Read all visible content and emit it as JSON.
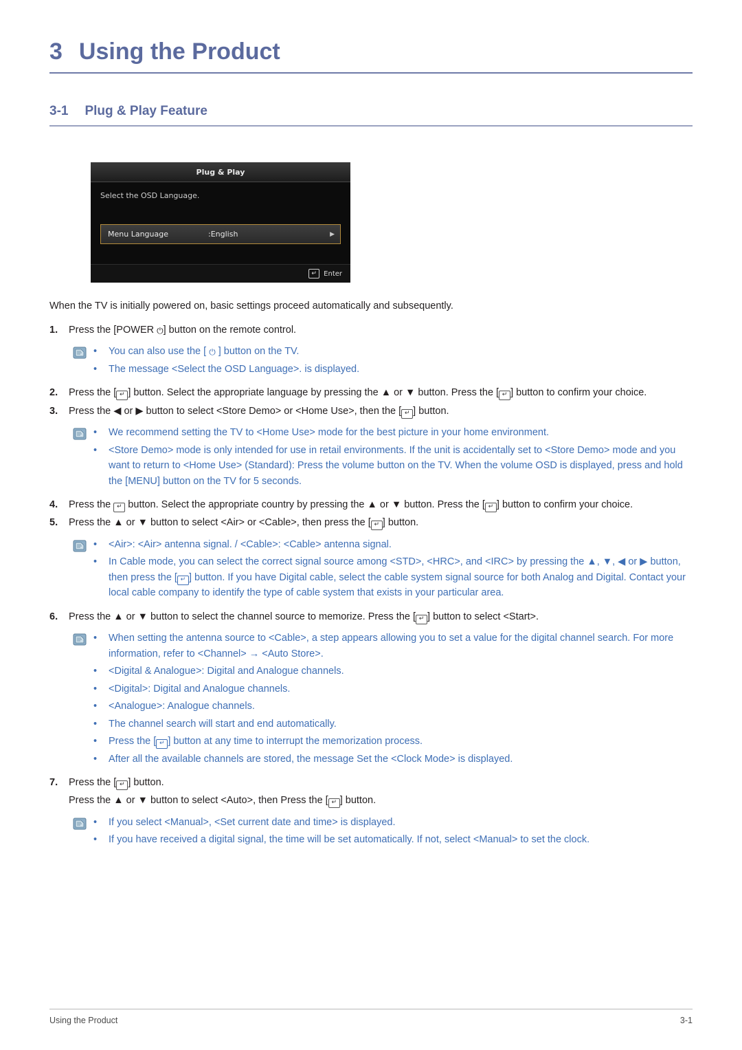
{
  "chapter": {
    "number": "3",
    "title": "Using the Product"
  },
  "section": {
    "number": "3-1",
    "title": "Plug & Play Feature"
  },
  "osd": {
    "title": "Plug & Play",
    "subtitle": "Select the OSD Language.",
    "row_label": "Menu Language",
    "row_value": ":English",
    "row_arrow": "▶",
    "footer_label": "Enter",
    "footer_key": "↵"
  },
  "intro": "When the TV is initially powered on, basic settings proceed automatically and subsequently.",
  "steps": [
    {
      "num": "1.",
      "parts": [
        {
          "t": "text",
          "v": "Press the [POWER "
        },
        {
          "t": "power",
          "v": "⏻"
        },
        {
          "t": "text",
          "v": "] button on the remote control."
        }
      ]
    },
    {
      "num": "2.",
      "parts": [
        {
          "t": "text",
          "v": "Press the ["
        },
        {
          "t": "key",
          "v": "↵"
        },
        {
          "t": "text",
          "v": "] button. Select the appropriate language by pressing the ▲ or ▼ button. Press the ["
        },
        {
          "t": "key",
          "v": "↵"
        },
        {
          "t": "text",
          "v": "] button to confirm your choice."
        }
      ]
    },
    {
      "num": "3.",
      "parts": [
        {
          "t": "text",
          "v": "Press the ◀ or ▶ button to select <Store Demo> or <Home Use>, then the ["
        },
        {
          "t": "key",
          "v": "↵"
        },
        {
          "t": "text",
          "v": "] button."
        }
      ]
    },
    {
      "num": "4.",
      "parts": [
        {
          "t": "text",
          "v": "Press the "
        },
        {
          "t": "key",
          "v": "↵"
        },
        {
          "t": "text",
          "v": " button. Select the appropriate country by pressing the ▲ or ▼ button. Press the ["
        },
        {
          "t": "key",
          "v": "↵"
        },
        {
          "t": "text",
          "v": "] button to confirm your choice."
        }
      ]
    },
    {
      "num": "5.",
      "parts": [
        {
          "t": "text",
          "v": "Press the ▲ or ▼ button to select <Air> or <Cable>, then press the ["
        },
        {
          "t": "key",
          "v": "↵"
        },
        {
          "t": "text",
          "v": "] button."
        }
      ]
    },
    {
      "num": "6.",
      "parts": [
        {
          "t": "text",
          "v": "Press the ▲ or ▼ button to select the channel source to memorize. Press the ["
        },
        {
          "t": "key",
          "v": "↵"
        },
        {
          "t": "text",
          "v": "] button to select <Start>."
        }
      ]
    },
    {
      "num": "7.",
      "parts": [
        {
          "t": "text",
          "v": "Press the ["
        },
        {
          "t": "key",
          "v": "↵"
        },
        {
          "t": "text",
          "v": "] button."
        }
      ]
    }
  ],
  "step7_extra": {
    "parts": [
      {
        "t": "text",
        "v": "Press the ▲ or ▼ button to select <Auto>, then Press the ["
      },
      {
        "t": "key",
        "v": "↵"
      },
      {
        "t": "text",
        "v": "] button."
      }
    ]
  },
  "notes": {
    "after_step1": [
      {
        "parts": [
          {
            "t": "text",
            "v": "You can also use the [ "
          },
          {
            "t": "power",
            "v": "⏻"
          },
          {
            "t": "text",
            "v": " ] button on the TV."
          }
        ]
      },
      {
        "parts": [
          {
            "t": "text",
            "v": "The message <Select the OSD Language>. is displayed."
          }
        ]
      }
    ],
    "after_step3": [
      {
        "parts": [
          {
            "t": "text",
            "v": "We recommend setting the TV to <Home Use> mode for the best picture in your home environment."
          }
        ]
      },
      {
        "parts": [
          {
            "t": "text",
            "v": "<Store Demo> mode is only intended for use in retail environments. If the unit is accidentally set to <Store Demo> mode and you want to return to <Home Use> (Standard): Press the volume button on the TV. When the volume OSD is displayed, press and hold the [MENU] button on the TV for 5 seconds."
          }
        ]
      }
    ],
    "after_step5": [
      {
        "parts": [
          {
            "t": "text",
            "v": "<Air>: <Air> antenna signal. / <Cable>: <Cable> antenna signal."
          }
        ]
      },
      {
        "parts": [
          {
            "t": "text",
            "v": "In Cable mode, you can select the correct signal source among <STD>, <HRC>, and <IRC> by pressing the ▲, ▼, ◀ or ▶ button, then press the ["
          },
          {
            "t": "key",
            "v": "↵"
          },
          {
            "t": "text",
            "v": "] button. If you have Digital cable, select the cable system signal source for both Analog and Digital. Contact your local cable company to identify the type of cable system that exists in your particular area."
          }
        ]
      }
    ],
    "after_step6": [
      {
        "parts": [
          {
            "t": "text",
            "v": "When setting the antenna source to <Cable>, a step appears allowing you to set a value for the digital channel search. For more information, refer to <Channel> → <Auto Store>."
          }
        ]
      },
      {
        "parts": [
          {
            "t": "text",
            "v": "<Digital & Analogue>: Digital and Analogue channels."
          }
        ]
      },
      {
        "parts": [
          {
            "t": "text",
            "v": "<Digital>: Digital and Analogue channels."
          }
        ]
      },
      {
        "parts": [
          {
            "t": "text",
            "v": "<Analogue>: Analogue channels."
          }
        ]
      },
      {
        "parts": [
          {
            "t": "text",
            "v": "The channel search will start and end automatically."
          }
        ]
      },
      {
        "parts": [
          {
            "t": "text",
            "v": "Press the ["
          },
          {
            "t": "key",
            "v": "↵"
          },
          {
            "t": "text",
            "v": "] button at any time to interrupt the memorization process."
          }
        ]
      },
      {
        "parts": [
          {
            "t": "text",
            "v": "After all the available channels are stored, the message Set the <Clock Mode> is displayed."
          }
        ]
      }
    ],
    "after_step7": [
      {
        "parts": [
          {
            "t": "text",
            "v": "If you select <Manual>, <Set current date and time> is displayed."
          }
        ]
      },
      {
        "parts": [
          {
            "t": "text",
            "v": "If you have received a digital signal, the time will be set automatically. If not, select <Manual> to set the clock."
          }
        ]
      }
    ]
  },
  "footer": {
    "left": "Using the Product",
    "right": "3-1"
  },
  "colors": {
    "heading": "#5b6a9e",
    "note_text": "#3f6fb5",
    "body": "#231f20"
  }
}
